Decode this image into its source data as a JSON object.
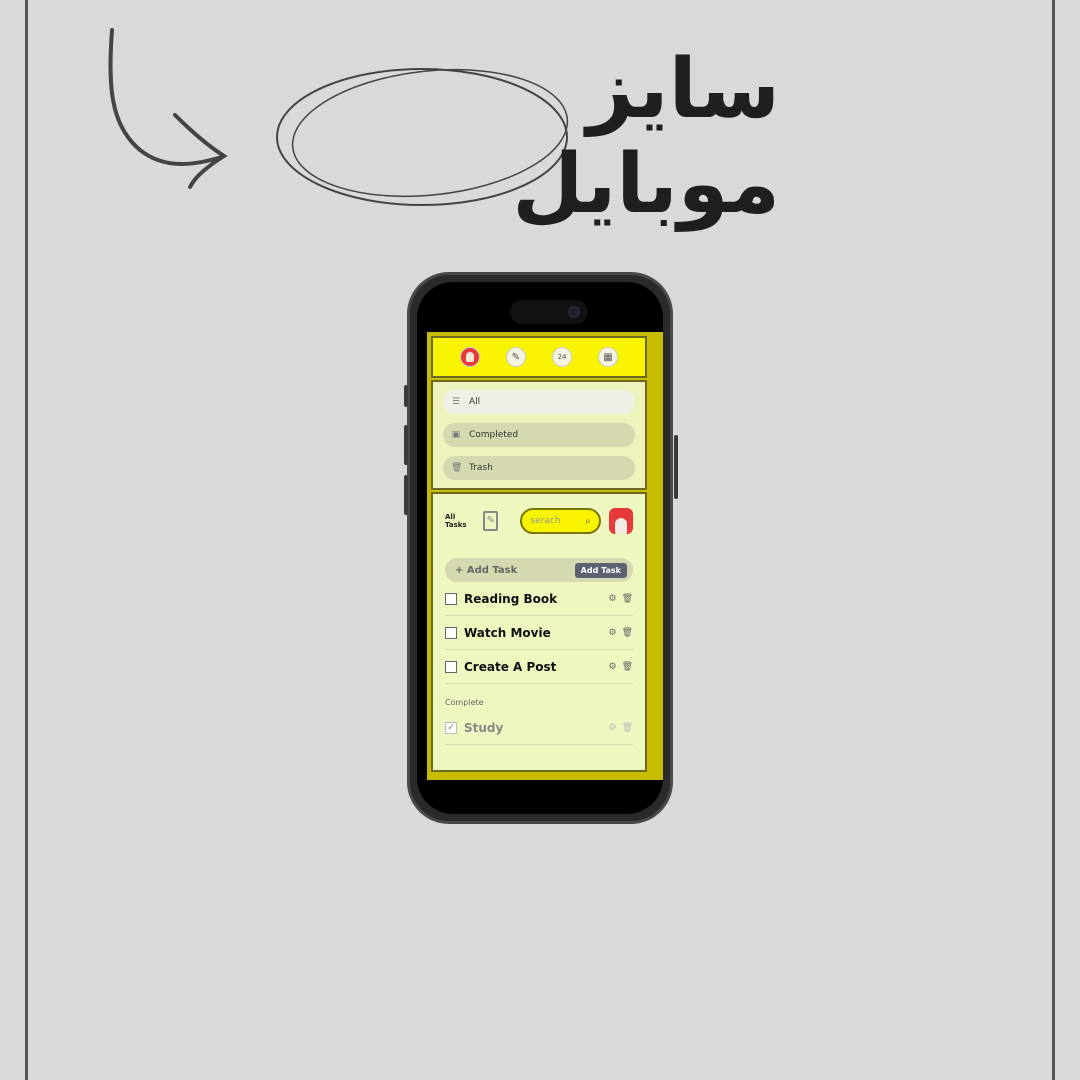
{
  "headline": {
    "text": "سايز موبايل"
  },
  "app": {
    "nav": [
      {
        "name": "avatar-icon",
        "glyph": ""
      },
      {
        "name": "clipboard-icon",
        "glyph": "✎"
      },
      {
        "name": "calendar-icon",
        "glyph": "24"
      },
      {
        "name": "gallery-icon",
        "glyph": "▦"
      }
    ],
    "filters": [
      {
        "label": "All",
        "icon": "☰"
      },
      {
        "label": "Completed",
        "icon": "▣"
      },
      {
        "label": "Trash",
        "icon": "🗑"
      }
    ],
    "all_tasks_label": "All Tasks",
    "search_placeholder": "serach",
    "add_task_placeholder": "+ Add Task",
    "add_task_button": "Add Task",
    "tasks": [
      {
        "label": "Reading Book",
        "done": false
      },
      {
        "label": "Watch Movie",
        "done": false
      },
      {
        "label": "Create A Post",
        "done": false
      }
    ],
    "complete_section_label": "Complete",
    "completed_tasks": [
      {
        "label": "Study",
        "done": true
      }
    ]
  },
  "colors": {
    "background": "#d9d9d9",
    "accent_yellow": "#f8f400",
    "panel": "#eef7c0",
    "avatar_red": "#e63a3a"
  }
}
